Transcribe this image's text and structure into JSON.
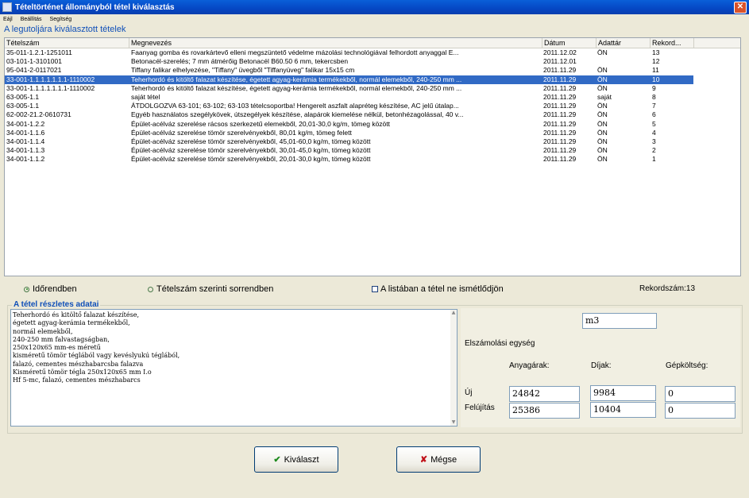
{
  "window": {
    "title": "Tételtörténet állományból tétel kiválasztás",
    "close_glyph": "✕"
  },
  "menu": [
    "Eájl",
    "Beállítás",
    "Segítség"
  ],
  "list_title": "A legutoljára kiválasztott tételek",
  "columns": [
    "Tételszám",
    "Megnevezés",
    "Dátum",
    "Adattár",
    "Rekord..."
  ],
  "rows": [
    [
      "35-011-1.2.1-1251011",
      "Faanyag gomba és rovarkártevő elleni megszüntető védelme mázolási technológiával felhordott anyaggal E...",
      "2011.12.02",
      "ÖN",
      "13"
    ],
    [
      "03-101-1-3101001",
      "Betonacél-szerelés; 7 mm átmérőig Betonacél B60.50  6 mm, tekercsben",
      "2011.12.01",
      "",
      "12"
    ],
    [
      "95-041-2-0117021",
      "Tiffany falikar elhelyezése, \"Tiffany\" üvegből \"Tiffanyüveg\" falikar 15x15 cm",
      "2011.11.29",
      "ÖN",
      "11"
    ],
    [
      "33-001-1.1.1.1.1.1.1-1110002",
      "Teherhordó és kitöltő falazat készítése, égetett agyag-kerámia termékekből, normál elemekből, 240-250 mm ...",
      "2011.11.29",
      "ÖN",
      "10"
    ],
    [
      "33-001-1.1.1.1.1.1.1-1110002",
      "Teherhordó és kitöltő falazat készítése, égetett agyag-kerámia termékekből, normál elemekből, 240-250 mm ...",
      "2011.11.29",
      "ÖN",
      "9"
    ],
    [
      "63-005-1.1",
      "saját tétel",
      "2011.11.29",
      "saját",
      "8"
    ],
    [
      "63-005-1.1",
      "ÁTDOLGOZVA 63-101; 63-102; 63-103 tételcsoportba! Hengerelt aszfalt alapréteg készítése, AC jelű útalap...",
      "2011.11.29",
      "ÖN",
      "7"
    ],
    [
      "62-002-21.2-0610731",
      "Egyéb használatos szegélykövek, útszegélyek készítése, alapárok kiemelése nélkül, betonhézagolással, 40 v...",
      "2011.11.29",
      "ÖN",
      "6"
    ],
    [
      "34-001-1.2.2",
      "Épület-acélváz szerelése rácsos szerkezetű elemekből, 20,01-30,0 kg/m, tömeg között",
      "2011.11.29",
      "ÖN",
      "5"
    ],
    [
      "34-001-1.1.6",
      "Épület-acélváz szerelése tömör szerelvényekből, 80,01 kg/m, tömeg felett",
      "2011.11.29",
      "ÖN",
      "4"
    ],
    [
      "34-001-1.1.4",
      "Épület-acélváz szerelése tömör szerelvényekből, 45,01-60,0 kg/m, tömeg között",
      "2011.11.29",
      "ÖN",
      "3"
    ],
    [
      "34-001-1.1.3",
      "Épület-acélváz szerelése tömör szerelvényekből, 30,01-45,0 kg/m, tömeg között",
      "2011.11.29",
      "ÖN",
      "2"
    ],
    [
      "34-001-1.1.2",
      "Épület-acélváz szerelése tömör szerelvényekből, 20,01-30,0 kg/m, tömeg között",
      "2011.11.29",
      "ÖN",
      "1"
    ]
  ],
  "selected_row": 3,
  "sort": {
    "option1": "Időrendben",
    "option2": "Tételszám szerinti sorrendben",
    "selected": 1
  },
  "repeat_check": {
    "label": "A listában a tétel ne ismétlődjön",
    "checked": false
  },
  "record_count": "Rekordszám:13",
  "details": {
    "title": "A tétel részletes adatai",
    "text_lines": [
      "Teherhordó és kitöltő falazat készítése,",
      "égetett agyag-kerámia termékekből,",
      "normál elemekből,",
      "240-250 mm falvastagságban,",
      "250x120x65 mm-es méretű",
      "kisméretű tömör téglából vagy kevéslyukú téglából,",
      "falazó, cementes mészhabarcsba falazva",
      "Kisméretű tömör tégla 250x120x65 mm I.o",
      "Hf 5-mc, falazó, cementes mészhabarcs"
    ],
    "unit_label": "Elszámolási egység",
    "unit_value": "m3",
    "headers": {
      "material": "Anyagárak:",
      "fees": "Díjak:",
      "machine": "Gépköltség:"
    },
    "row_new": {
      "label": "Új",
      "material": "24842",
      "fees": "9984",
      "machine": "0"
    },
    "row_renovation": {
      "label": "Felújítás",
      "material": "25386",
      "fees": "10404",
      "machine": "0"
    }
  },
  "buttons": {
    "select": {
      "label": "Kiválaszt",
      "icon": "✔"
    },
    "cancel": {
      "label": "Mégse",
      "icon": "✘"
    }
  },
  "colors": {
    "selection": "#316ac5",
    "title_blue": "#0f4fb8",
    "ok_green": "#1d8a1d",
    "cancel_red": "#c0121a"
  }
}
